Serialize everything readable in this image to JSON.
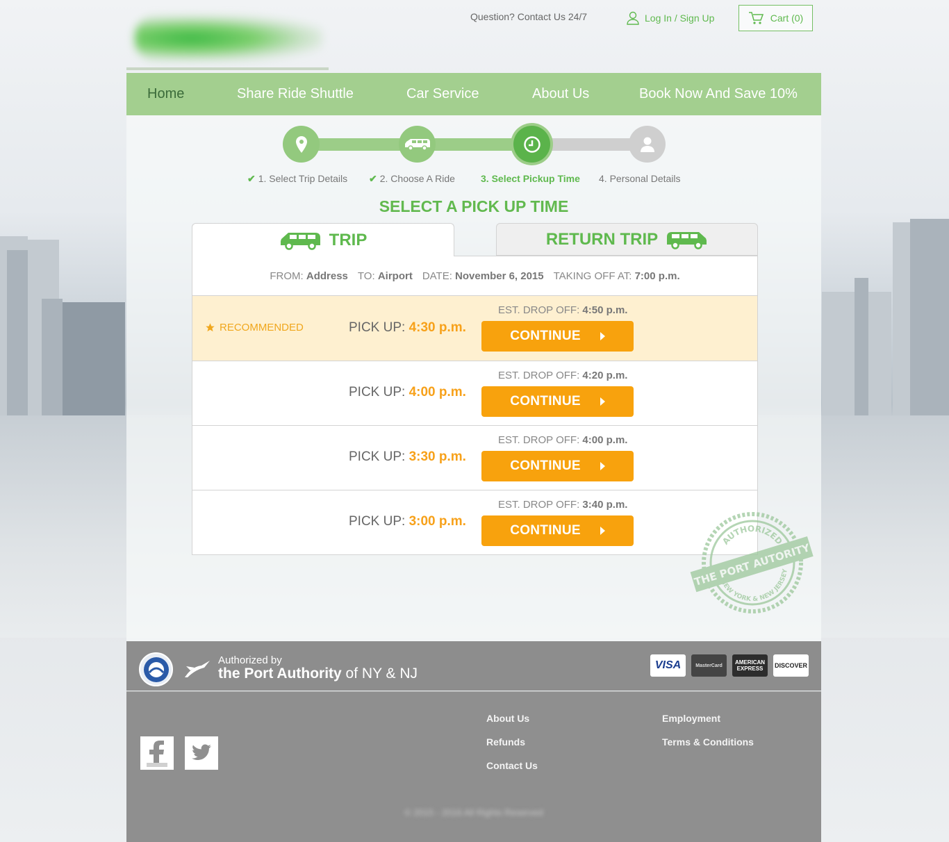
{
  "header": {
    "contact": "Question? Contact Us 24/7",
    "login": "Log In / Sign Up",
    "cart": "Cart (0)"
  },
  "nav": {
    "items": [
      "Home",
      "Share Ride Shuttle",
      "Car Service",
      "About Us",
      "Book Now And Save 10%"
    ],
    "active": "Home"
  },
  "steps": [
    {
      "label": "1. Select Trip Details",
      "state": "done",
      "icon": "map-pin-icon"
    },
    {
      "label": "2. Choose A Ride",
      "state": "done",
      "icon": "van-icon"
    },
    {
      "label": "3. Select Pickup Time",
      "state": "current",
      "icon": "clock-icon"
    },
    {
      "label": "4. Personal Details",
      "state": "pending",
      "icon": "user-icon"
    }
  ],
  "heading": "SELECT A PICK UP TIME",
  "tabs": {
    "trip": "TRIP",
    "return": "RETURN TRIP"
  },
  "trip_info": {
    "from_label": "FROM:",
    "from": "Address",
    "to_label": "TO:",
    "to": "Airport",
    "date_label": "DATE:",
    "date": "November 6, 2015",
    "takeoff_label": "TAKING OFF AT:",
    "takeoff": "7:00 p.m."
  },
  "options": [
    {
      "recommended": "RECOMMENDED",
      "pickup_label": "PICK UP:",
      "pickup": "4:30 p.m.",
      "drop_label": "EST. DROP OFF:",
      "drop": "4:50 p.m.",
      "button": "CONTINUE"
    },
    {
      "pickup_label": "PICK UP:",
      "pickup": "4:00 p.m.",
      "drop_label": "EST. DROP OFF:",
      "drop": "4:20 p.m.",
      "button": "CONTINUE"
    },
    {
      "pickup_label": "PICK UP:",
      "pickup": "3:30 p.m.",
      "drop_label": "EST. DROP OFF:",
      "drop": "4:00 p.m.",
      "button": "CONTINUE"
    },
    {
      "pickup_label": "PICK UP:",
      "pickup": "3:00 p.m.",
      "drop_label": "EST. DROP OFF:",
      "drop": "3:40 p.m.",
      "button": "CONTINUE"
    }
  ],
  "stamp": {
    "top": "AUTHORIZED",
    "main": "THE PORT AUTORITY",
    "bottom": "OF NEW YORK & NEW JERSEY"
  },
  "footer": {
    "auth_small": "Authorized by",
    "auth_bold": "the Port Authority",
    "auth_rest": " of NY & NJ",
    "cards": [
      "VISA",
      "MasterCard",
      "AMERICAN EXPRESS",
      "DISCOVER"
    ],
    "links_col1": [
      "About Us",
      "Refunds",
      "Contact Us"
    ],
    "links_col2": [
      "Employment",
      "Terms & Conditions"
    ],
    "copyright": "© 2015 - 2016 All Rights Reserved"
  },
  "colors": {
    "brand_green": "#5fb94e",
    "nav_green": "#a3cf8f",
    "accent_orange": "#f8a20d",
    "recommended_bg": "#fef0d0"
  }
}
